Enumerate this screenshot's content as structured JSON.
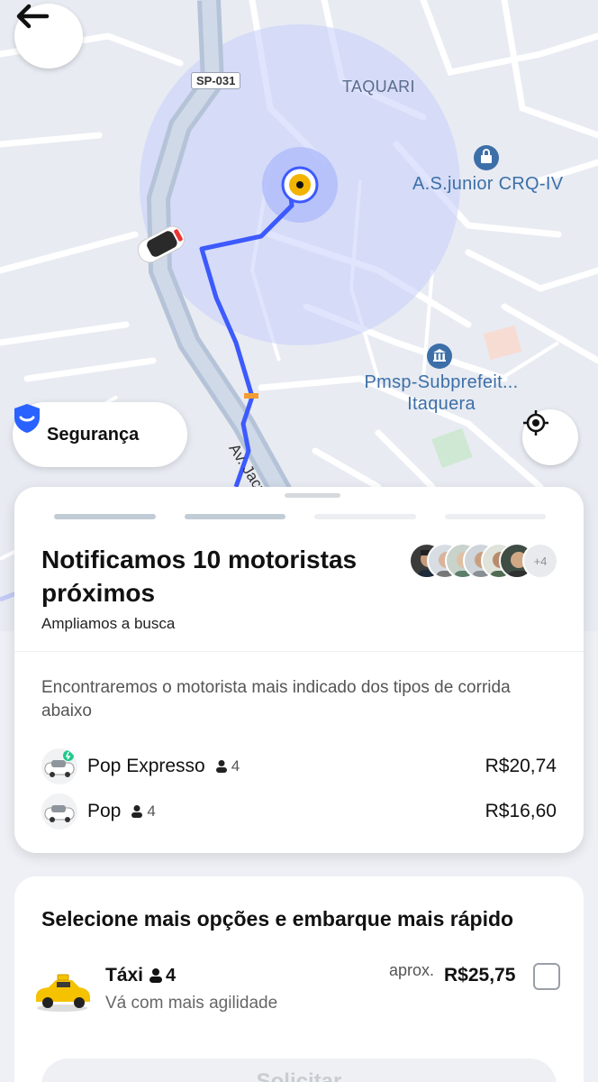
{
  "map": {
    "road_badge": "SP-031",
    "district_label": "TAQUARI",
    "poi_1": "A.S.junior CRQ-IV",
    "poi_2_line1": "Pmsp-Subprefeit...",
    "poi_2_line2": "Itaquera",
    "street_label": "Av. Jacu-Pê",
    "route_color": "#3d5afe",
    "search_radius_color": "#c5cdfa"
  },
  "controls": {
    "back_icon": "arrow-left-icon",
    "safety_label": "Segurança",
    "safety_icon": "shield-icon",
    "locate_icon": "crosshair-icon"
  },
  "status_card": {
    "progress_steps": 4,
    "progress_completed": 2,
    "title": "Notificamos 10 motoristas próximos",
    "subtitle": "Ampliamos a busca",
    "extra_drivers": "+4",
    "info": "Encontraremos o motorista mais indicado dos tipos de corrida abaixo",
    "options": [
      {
        "name": "Pop Expresso",
        "seats": "4",
        "price": "R$20,74",
        "icon": "car-express-icon"
      },
      {
        "name": "Pop",
        "seats": "4",
        "price": "R$16,60",
        "icon": "car-icon"
      }
    ]
  },
  "more_options": {
    "title": "Selecione mais opções e embarque mais rápido",
    "taxi": {
      "name": "Táxi",
      "seats": "4",
      "description": "Vá com mais agilidade",
      "price_prefix": "aprox.",
      "price": "R$25,75"
    },
    "request_button": "Solicitar"
  }
}
